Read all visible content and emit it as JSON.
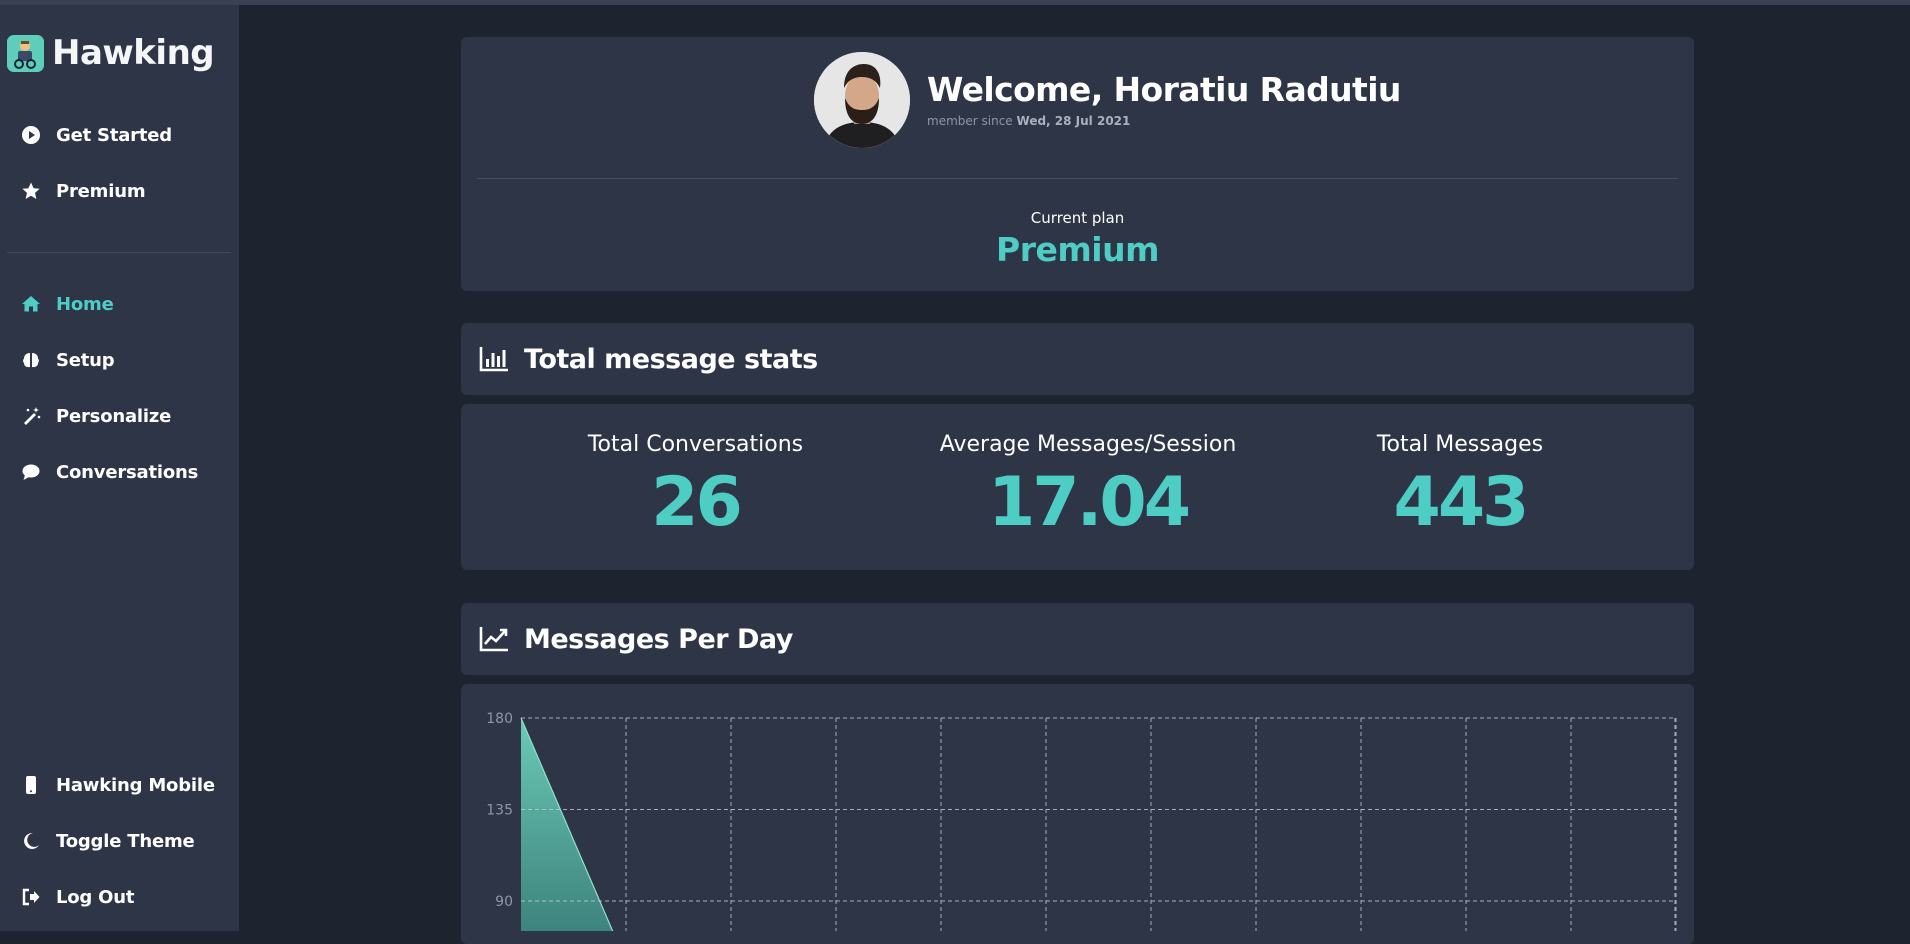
{
  "app": {
    "name": "Hawking"
  },
  "sidebar": {
    "top_items": [
      {
        "label": "Get Started",
        "icon": "play-circle-icon"
      },
      {
        "label": "Premium",
        "icon": "star-icon"
      }
    ],
    "main_items": [
      {
        "label": "Home",
        "icon": "home-icon",
        "active": true
      },
      {
        "label": "Setup",
        "icon": "brain-icon"
      },
      {
        "label": "Personalize",
        "icon": "magic-wand-icon"
      },
      {
        "label": "Conversations",
        "icon": "chat-bubble-icon"
      }
    ],
    "bottom_items": [
      {
        "label": "Hawking Mobile",
        "icon": "mobile-phone-icon"
      },
      {
        "label": "Toggle Theme",
        "icon": "moon-icon"
      },
      {
        "label": "Log Out",
        "icon": "log-out-icon"
      }
    ]
  },
  "profile": {
    "welcome": "Welcome, Horatiu Radutiu",
    "member_prefix": "member since",
    "member_date": "Wed, 28 Jul 2021",
    "plan_label": "Current plan",
    "plan_value": "Premium"
  },
  "stats": {
    "title": "Total message stats",
    "items": [
      {
        "label": "Total Conversations",
        "value": "26"
      },
      {
        "label": "Average Messages/Session",
        "value": "17.04"
      },
      {
        "label": "Total Messages",
        "value": "443"
      }
    ]
  },
  "chart_section": {
    "title": "Messages Per Day"
  },
  "colors": {
    "accent": "#4ecdc4",
    "sidebar_bg": "#2d3547",
    "page_bg": "#1e2330",
    "card_bg": "#2d3547"
  },
  "chart_data": {
    "type": "area",
    "y_ticks": [
      "180",
      "135",
      "90"
    ],
    "ylim": [
      0,
      180
    ],
    "grid": true,
    "series": [
      {
        "values": [
          180,
          60
        ]
      }
    ]
  }
}
